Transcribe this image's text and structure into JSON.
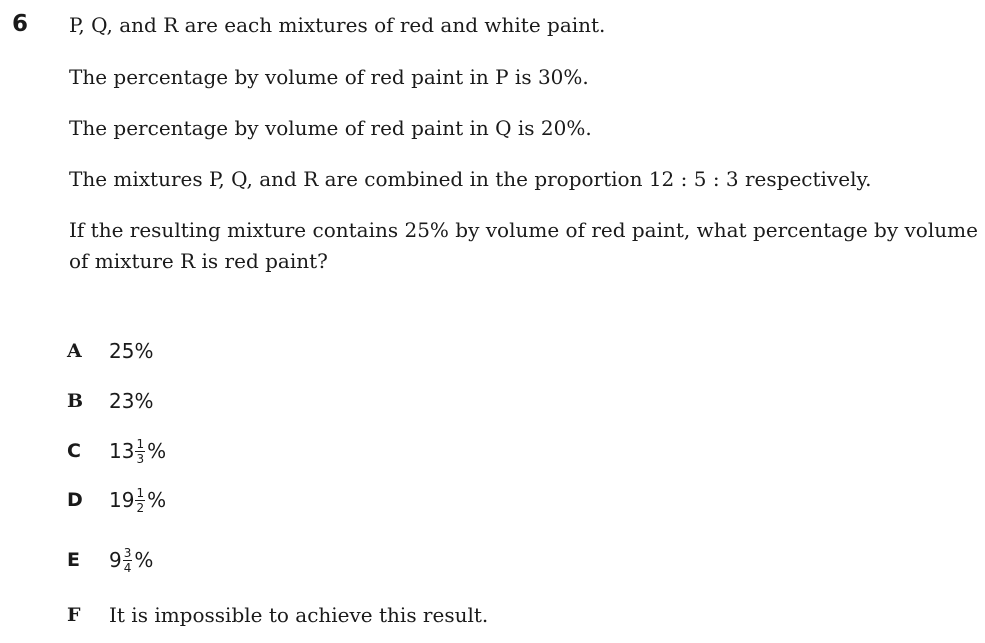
{
  "question": {
    "number": "6",
    "paragraphs": [
      "P, Q, and R are each mixtures of red and white paint.",
      "The percentage by volume of red paint in P is 30%.",
      "The percentage by volume of red paint in Q is 20%.",
      "The mixtures P, Q, and R are combined in the proportion 12 : 5 : 3 respectively.",
      "If the resulting mixture contains 25% by volume of red paint, what percentage by volume of mixture R is red paint?"
    ]
  },
  "options": [
    {
      "letter": "A",
      "text": "25%"
    },
    {
      "letter": "B",
      "text": "23%"
    },
    {
      "letter": "C",
      "whole": "13",
      "numerator": "1",
      "denominator": "3",
      "suffix": "%"
    },
    {
      "letter": "D",
      "whole": "19",
      "numerator": "1",
      "denominator": "2",
      "suffix": "%"
    },
    {
      "letter": "E",
      "whole": "9",
      "numerator": "3",
      "denominator": "4",
      "suffix": "%"
    },
    {
      "letter": "F",
      "text": "It is impossible to achieve this result."
    }
  ]
}
